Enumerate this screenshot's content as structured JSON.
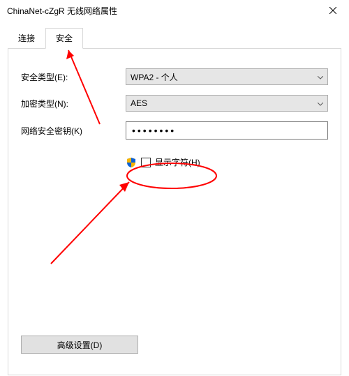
{
  "window": {
    "title": "ChinaNet-cZgR 无线网络属性"
  },
  "tabs": {
    "connection": "连接",
    "security": "安全"
  },
  "form": {
    "securityTypeLabel": "安全类型(E):",
    "securityTypeValue": "WPA2 - 个人",
    "encryptionTypeLabel": "加密类型(N):",
    "encryptionTypeValue": "AES",
    "networkKeyLabel": "网络安全密钥(K)",
    "networkKeyValue": "••••••••",
    "showCharsLabel": "显示字符(H)"
  },
  "buttons": {
    "advanced": "高级设置(D)"
  }
}
